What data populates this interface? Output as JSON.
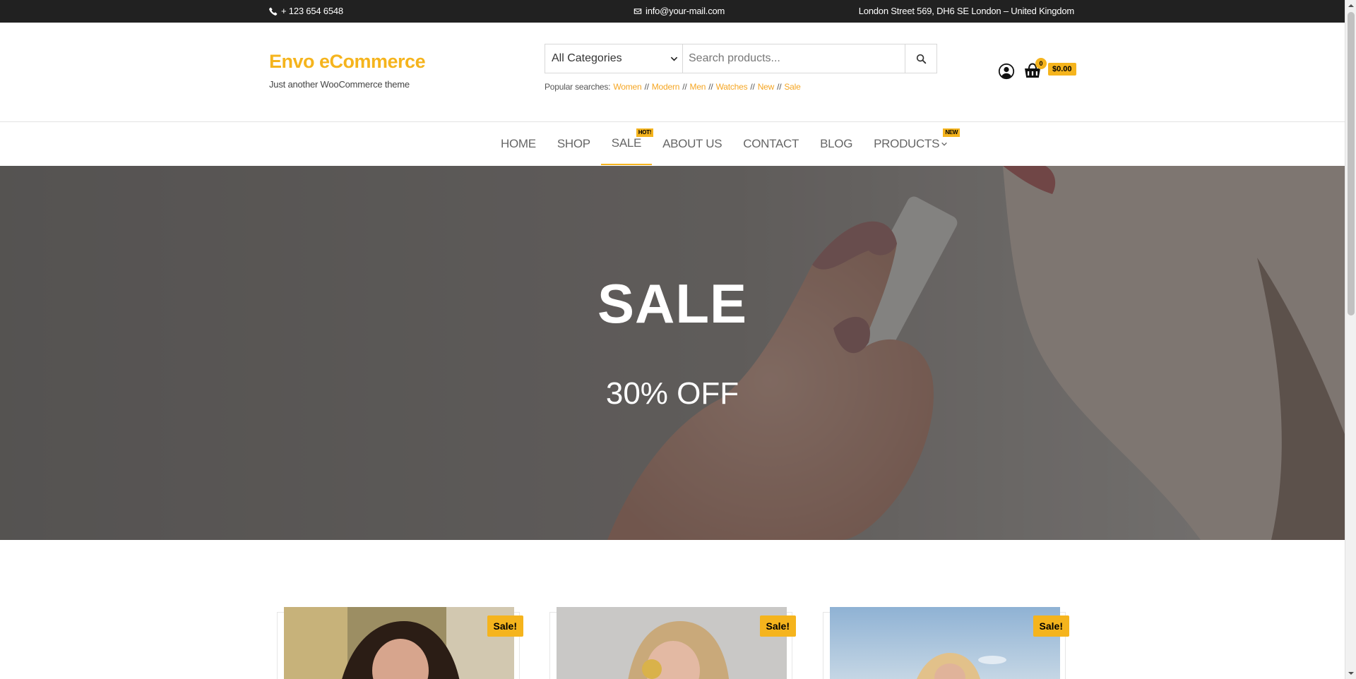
{
  "topbar": {
    "phone": "+ 123 654 6548",
    "email": "info@your-mail.com",
    "address": "London Street 569, DH6 SE London – United Kingdom"
  },
  "header": {
    "site_title": "Envo eCommerce",
    "tagline": "Just another WooCommerce theme",
    "search": {
      "category_selected": "All Categories",
      "placeholder": "Search products..."
    },
    "popular_label": "Popular searches:",
    "popular_terms": [
      "Women",
      "Modern",
      "Men",
      "Watches",
      "New",
      "Sale"
    ],
    "popular_sep": "//",
    "cart": {
      "count": "0",
      "total": "$0.00"
    }
  },
  "nav": {
    "items": [
      {
        "label": "HOME"
      },
      {
        "label": "SHOP"
      },
      {
        "label": "SALE",
        "badge": "HOT!"
      },
      {
        "label": "ABOUT US"
      },
      {
        "label": "CONTACT"
      },
      {
        "label": "BLOG"
      },
      {
        "label": "PRODUCTS",
        "badge": "NEW"
      }
    ]
  },
  "hero": {
    "title": "SALE",
    "subtitle": "30% OFF"
  },
  "products": {
    "sale_badge": "Sale!"
  },
  "colors": {
    "accent": "#f5b41d",
    "topbar": "#212121",
    "link": "#f5a623"
  }
}
